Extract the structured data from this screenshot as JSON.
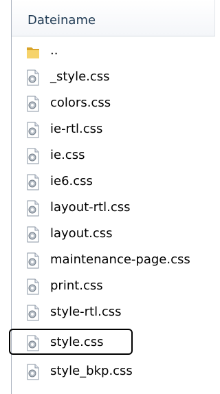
{
  "header": {
    "column_label": "Dateiname"
  },
  "files": [
    {
      "name": "..",
      "icon": "folder-icon"
    },
    {
      "name": "_style.css",
      "icon": "css-file-icon"
    },
    {
      "name": "colors.css",
      "icon": "css-file-icon"
    },
    {
      "name": "ie-rtl.css",
      "icon": "css-file-icon"
    },
    {
      "name": "ie.css",
      "icon": "css-file-icon"
    },
    {
      "name": "ie6.css",
      "icon": "css-file-icon"
    },
    {
      "name": "layout-rtl.css",
      "icon": "css-file-icon"
    },
    {
      "name": "layout.css",
      "icon": "css-file-icon"
    },
    {
      "name": "maintenance-page.css",
      "icon": "css-file-icon"
    },
    {
      "name": "print.css",
      "icon": "css-file-icon"
    },
    {
      "name": "style-rtl.css",
      "icon": "css-file-icon"
    },
    {
      "name": "style.css",
      "icon": "css-file-icon",
      "selected": true
    },
    {
      "name": "style_bkp.css",
      "icon": "css-file-icon"
    }
  ],
  "colors": {
    "highlight": "#f3f7b3",
    "header_text": "#1e3952",
    "folder": "#f2c94c"
  }
}
